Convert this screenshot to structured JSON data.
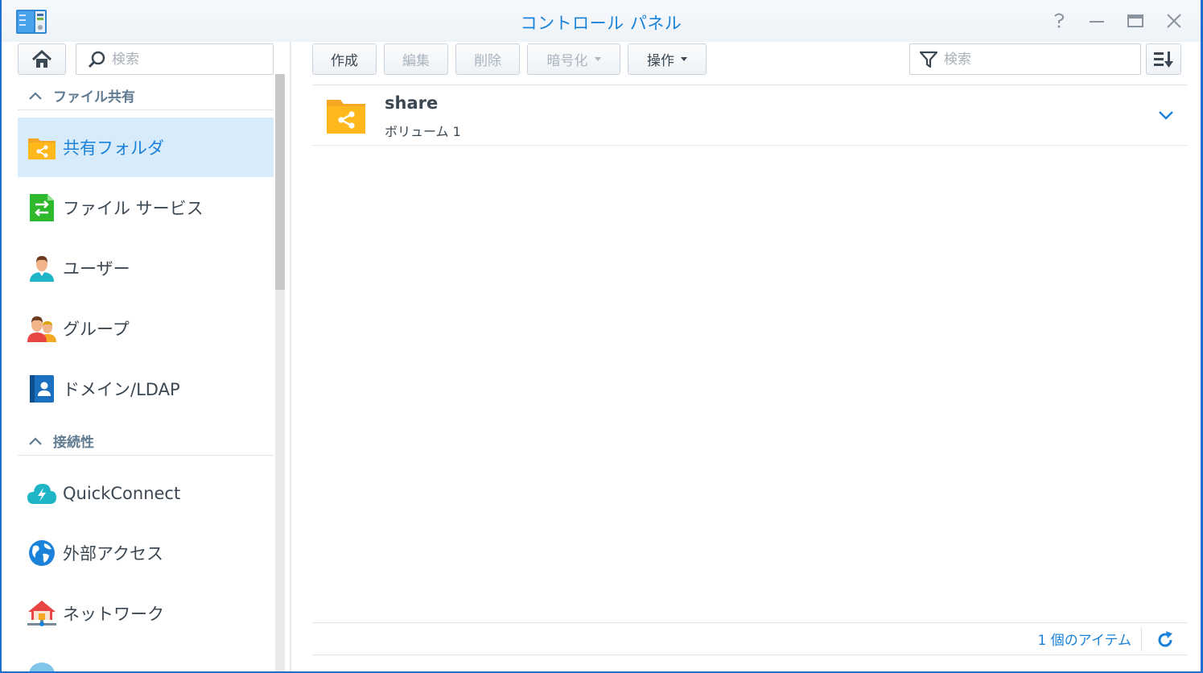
{
  "window": {
    "title": "コントロール パネル",
    "accent_color": "#1a82d8",
    "border_color": "#1e6fd1",
    "help_icon": "question-icon",
    "minimize_icon": "minimize-icon",
    "maximize_icon": "maximize-icon",
    "close_icon": "close-icon"
  },
  "sidebar": {
    "search_placeholder": "検索",
    "sections": [
      {
        "label": "ファイル共有",
        "items": [
          {
            "label": "共有フォルダ",
            "icon": "shared-folder-icon",
            "active": true
          },
          {
            "label": "ファイル サービス",
            "icon": "file-services-icon"
          },
          {
            "label": "ユーザー",
            "icon": "user-icon"
          },
          {
            "label": "グループ",
            "icon": "group-icon"
          },
          {
            "label": "ドメイン/LDAP",
            "icon": "domain-ldap-icon"
          }
        ]
      },
      {
        "label": "接続性",
        "items": [
          {
            "label": "QuickConnect",
            "icon": "quickconnect-icon"
          },
          {
            "label": "外部アクセス",
            "icon": "external-access-icon"
          },
          {
            "label": "ネットワーク",
            "icon": "network-icon"
          }
        ]
      }
    ]
  },
  "toolbar": {
    "create": "作成",
    "edit": "編集",
    "delete": "削除",
    "encrypt": "暗号化",
    "action": "操作",
    "filter_placeholder": "検索"
  },
  "list": {
    "rows": [
      {
        "name": "share",
        "volume": "ボリューム 1",
        "icon": "shared-folder-icon"
      }
    ]
  },
  "footer": {
    "count": "1 個のアイテム"
  }
}
